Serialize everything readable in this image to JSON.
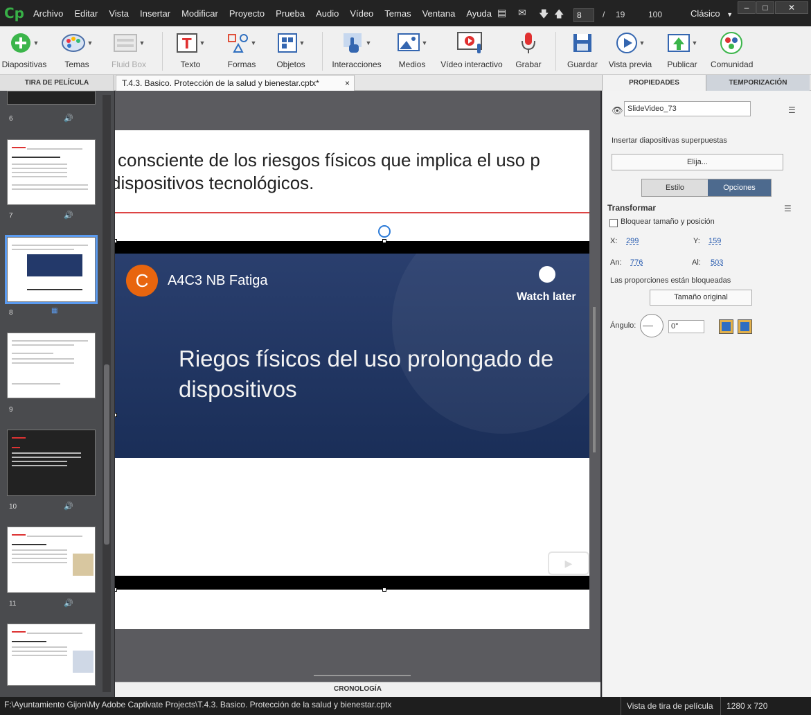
{
  "app": {
    "logo": "Cp"
  },
  "menu": [
    "Archivo",
    "Editar",
    "Vista",
    "Insertar",
    "Modificar",
    "Proyecto",
    "Prueba",
    "Audio",
    "Vídeo",
    "Temas",
    "Ventana",
    "Ayuda"
  ],
  "nav": {
    "current_slide": "8",
    "separator": "/",
    "total_slides": "19",
    "zoom": "100",
    "workspace": "Clásico"
  },
  "toolbar": {
    "diapositivas": "Diapositivas",
    "temas": "Temas",
    "fluid_box": "Fluid Box",
    "texto": "Texto",
    "formas": "Formas",
    "objetos": "Objetos",
    "interacciones": "Interacciones",
    "medios": "Medios",
    "video_interactivo": "Vídeo interactivo",
    "grabar": "Grabar",
    "guardar": "Guardar",
    "vista_previa": "Vista previa",
    "publicar": "Publicar",
    "comunidad": "Comunidad"
  },
  "tabs": {
    "filmstrip": "TIRA DE PELÍCULA",
    "document": "T.4.3. Basico. Protección de la salud y bienestar.cptx*",
    "close": "×",
    "properties": "PROPIEDADES",
    "timing": "TEMPORIZACIÓN"
  },
  "filmstrip": {
    "slides": [
      {
        "number": "6",
        "has_audio": true
      },
      {
        "number": "7",
        "has_audio": true
      },
      {
        "number": "8",
        "has_audio": false,
        "selected": true
      },
      {
        "number": "9",
        "has_audio": false
      },
      {
        "number": "10",
        "has_audio": true
      },
      {
        "number": "11",
        "has_audio": true
      }
    ]
  },
  "slide": {
    "title_line1": "conscient​e de los riesgos físicos que implica el uso p",
    "title_line2": "dispositivos tecnológicos.",
    "video": {
      "avatar_letter": "C",
      "channel": "A4C3 NB Fatiga",
      "watch_later": "Watch later",
      "title": "Riegos físicos del uso prolongado de dispositivos"
    }
  },
  "timeline": {
    "label": "CRONOLOGÍA"
  },
  "properties": {
    "object_name": "SlideVideo_73",
    "insert_label": "Insertar diapositivas superpuestas",
    "choose_button": "Elija...",
    "tab_style": "Estilo",
    "tab_options": "Opciones",
    "transform_title": "Transformar",
    "lock_label": "Bloquear tamaño y posición",
    "x_label": "X:",
    "x_value": "299",
    "y_label": "Y:",
    "y_value": "159",
    "w_label": "An:",
    "w_value": "776",
    "h_label": "Al:",
    "h_value": "503",
    "proportions_locked": "Las proporciones están bloqueadas",
    "original_size_button": "Tamaño original",
    "angle_label": "Ángulo:",
    "angle_value": "0°"
  },
  "status": {
    "path": "F:\\Ayuntamiento Gijon\\My Adobe Captivate Projects\\T.4.3. Basico. Protección de la salud y bienestar.cptx",
    "view_mode": "Vista de tira de película",
    "resolution": "1280 x 720"
  }
}
